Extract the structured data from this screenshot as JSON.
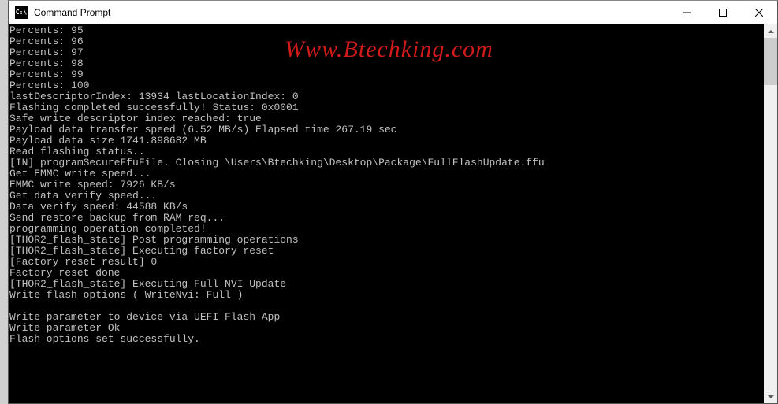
{
  "window": {
    "title": "Command Prompt",
    "icon_label": "C:\\"
  },
  "watermark": "Www.Btechking.com",
  "console_lines": [
    "Percents: 95",
    "Percents: 96",
    "Percents: 97",
    "Percents: 98",
    "Percents: 99",
    "Percents: 100",
    "lastDescriptorIndex: 13934 lastLocationIndex: 0",
    "Flashing completed successfully! Status: 0x0001",
    "Safe write descriptor index reached: true",
    "Payload data transfer speed (6.52 MB/s) Elapsed time 267.19 sec",
    "Payload data size 1741.898682 MB",
    "Read flashing status..",
    "[IN] programSecureFfuFile. Closing \\Users\\Btechking\\Desktop\\Package\\FullFlashUpdate.ffu",
    "Get EMMC write speed...",
    "EMMC write speed: 7926 KB/s",
    "Get data verify speed...",
    "Data verify speed: 44588 KB/s",
    "Send restore backup from RAM req...",
    "programming operation completed!",
    "[THOR2_flash_state] Post programming operations",
    "[THOR2_flash_state] Executing factory reset",
    "[Factory reset result] 0",
    "Factory reset done",
    "[THOR2_flash_state] Executing Full NVI Update",
    "Write flash options ( WriteNvi: Full )",
    "",
    "Write parameter to device via UEFI Flash App",
    "Write parameter Ok",
    "Flash options set successfully.",
    ""
  ]
}
